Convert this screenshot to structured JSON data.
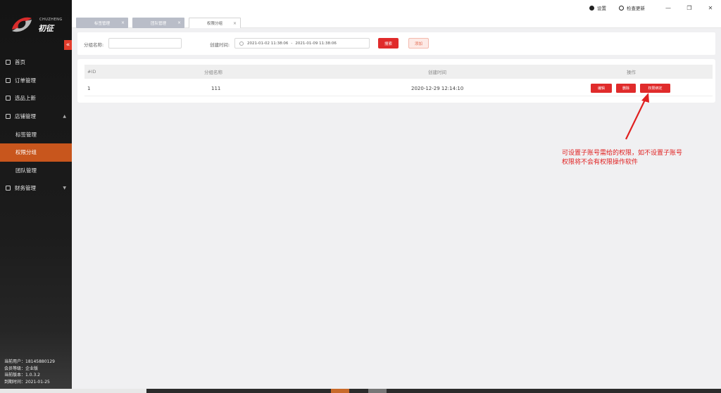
{
  "brand": {
    "name_en": "CHUZHENG",
    "name_cn": "初征",
    "collapse_icon": "«",
    "accent": "#c8561d"
  },
  "sidebar": {
    "items": [
      {
        "label": "首页",
        "icon": "home-icon"
      },
      {
        "label": "订单管理",
        "icon": "order-icon"
      },
      {
        "label": "选品上新",
        "icon": "product-icon"
      },
      {
        "label": "店铺管理",
        "icon": "store-icon",
        "chevron": "▲"
      },
      {
        "label": "标签管理",
        "sub": true
      },
      {
        "label": "权限分组",
        "sub": true,
        "active": true
      },
      {
        "label": "团队管理",
        "sub": true
      },
      {
        "label": "财务管理",
        "icon": "finance-icon",
        "chevron": "▼"
      }
    ]
  },
  "user_info": {
    "current_user": "当前用户：18145880129",
    "member_level": "会员等级：企业版",
    "version": "当前版本：1.0.3.2",
    "expiry": "到期时间：2021-01-25"
  },
  "topbar": {
    "settings_label": "设置",
    "update_label": "检查更新",
    "minimize": "—",
    "restore": "❐",
    "close": "✕"
  },
  "tabs": [
    {
      "label": "标签管理",
      "close": "×"
    },
    {
      "label": "团队管理",
      "close": "×"
    },
    {
      "label": "权限分组",
      "close": "×",
      "active": true
    }
  ],
  "filter": {
    "group_name_label": "分组名称:",
    "group_name_value": "",
    "created_label": "创建时间:",
    "date_start": "2021-01-02 11:38:06",
    "date_sep": "-",
    "date_end": "2021-01-09 11:38:06",
    "search_button": "搜索",
    "add_button": "添加"
  },
  "table": {
    "headers": [
      "#ID",
      "分组名称",
      "创建时间",
      "操作"
    ],
    "rows": [
      {
        "id": "1",
        "name": "111",
        "created": "2020-12-29 12:14:10"
      }
    ],
    "actions": {
      "edit": "编辑",
      "delete": "删除",
      "bind": "权限绑定"
    }
  },
  "annotation": {
    "line1": "可设置子账号需给的权限，如不设置子账号",
    "line2": "权限将不会有权限操作软件",
    "color": "#e02020"
  }
}
